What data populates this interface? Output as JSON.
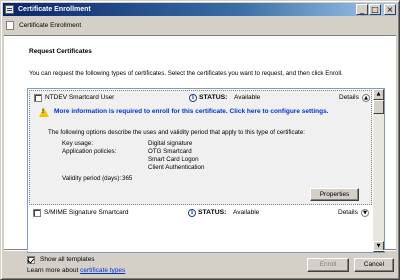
{
  "window": {
    "title": "Certificate Enrollment",
    "header": "Certificate Enrollment",
    "controls": {
      "minimize": "_",
      "maximize": "□",
      "close": "×"
    }
  },
  "page": {
    "section_title": "Request Certificates",
    "intro": "You can request the following types of certificates. Select the certificates you want to request, and then click Enroll."
  },
  "certificates": [
    {
      "name": "NTDEV Smartcard User",
      "checked": false,
      "status_label": "STATUS:",
      "status_value": "Available",
      "details_label": "Details",
      "warning": "More information is required to enroll for this certificate. Click here to configure settings.",
      "description": "The following options describe the uses and validity period that apply to this type of certificate:",
      "key_usage_label": "Key usage:",
      "key_usage_value": "Digital signature",
      "app_policies_label": "Application policies:",
      "app_policies": [
        "OTG Smartcard",
        "Smart Card Logon",
        "Client Authentication"
      ],
      "validity_label": "Validity period (days):",
      "validity_value": "365",
      "properties_label": "Properties"
    },
    {
      "name": "S/MIME Signature  Smartcard",
      "checked": false,
      "status_label": "STATUS:",
      "status_value": "Available",
      "details_label": "Details"
    }
  ],
  "options": {
    "show_all_label": "Show all templates",
    "show_all_checked": true,
    "learn_prefix": "Learn more about ",
    "learn_link": "certificate types"
  },
  "buttons": {
    "enroll": "Enroll",
    "cancel": "Cancel"
  },
  "colors": {
    "title_start": "#0a246a",
    "title_end": "#a6caf0",
    "link": "#0033cc",
    "warning": "#f5c400"
  },
  "icons": [
    "certificate-icon",
    "info-icon",
    "warning-icon",
    "chevron-up-icon",
    "chevron-down-icon"
  ]
}
